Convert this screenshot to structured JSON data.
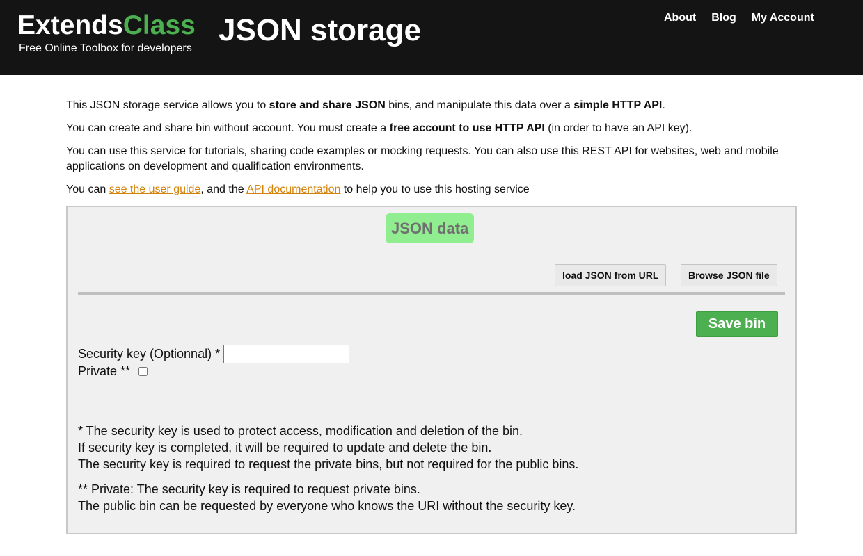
{
  "header": {
    "brand_main": "Extends",
    "brand_accent": "Class",
    "tagline": "Free Online Toolbox for developers",
    "page_title": "JSON storage",
    "nav": [
      "About",
      "Blog",
      "My Account"
    ]
  },
  "intro": {
    "p1_a": "This JSON storage service allows you to ",
    "p1_b": "store and share JSON",
    "p1_c": " bins, and manipulate this data over a ",
    "p1_d": "simple HTTP API",
    "p1_e": ".",
    "p2_a": "You can create and share bin without account. You must create a ",
    "p2_b": "free account to use HTTP API",
    "p2_c": " (in order to have an API key).",
    "p3": "You can use this service for tutorials, sharing code examples or mocking requests. You can also use this REST API for websites, web and mobile applications on development and qualification environments.",
    "p4_a": "You can ",
    "p4_link1": "see the user guide",
    "p4_b": ", and the ",
    "p4_link2": "API documentation",
    "p4_c": " to help you to use this hosting service"
  },
  "panel": {
    "title": "JSON data",
    "load_url_label": "load JSON from URL",
    "browse_file_label": "Browse JSON file",
    "save_label": "Save bin",
    "security_key_label": "Security key (Optionnal) *",
    "security_key_value": "",
    "private_label": "Private **",
    "private_checked": false,
    "notes": {
      "n1": "* The security key is used to protect access, modification and deletion of the bin.",
      "n2": "If security key is completed, it will be required to update and delete the bin.",
      "n3": "The security key is required to request the private bins, but not required for the public bins.",
      "n4": "** Private: The security key is required to request private bins.",
      "n5": "The public bin can be requested by everyone who knows the URI without the security key."
    }
  },
  "colors": {
    "header_bg": "#141414",
    "brand_accent": "#4caf50",
    "link": "#d4820a",
    "panel_title_bg": "#90ee90",
    "save_button": "#4caf50"
  }
}
